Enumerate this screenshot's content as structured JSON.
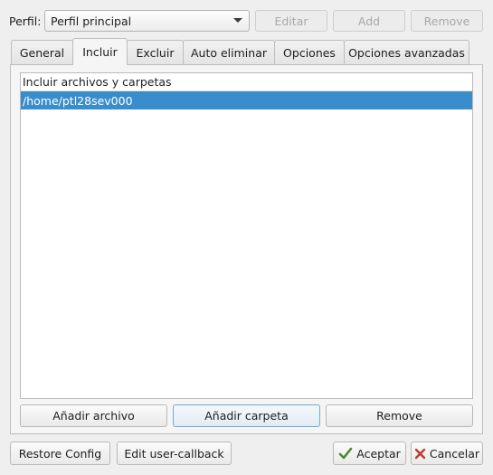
{
  "profile": {
    "label": "Perfil:",
    "selected": "Perfil principal",
    "buttons": {
      "edit": "Editar",
      "add": "Add",
      "remove": "Remove"
    }
  },
  "tabs": [
    {
      "label": "General",
      "active": false
    },
    {
      "label": "Incluir",
      "active": true
    },
    {
      "label": "Excluir",
      "active": false
    },
    {
      "label": "Auto eliminar",
      "active": false
    },
    {
      "label": "Opciones",
      "active": false
    },
    {
      "label": "Opciones avanzadas",
      "active": false
    }
  ],
  "include_list": {
    "header": "Incluir archivos y carpetas",
    "rows": [
      "/home/ptl28sev000"
    ],
    "selected_index": 0
  },
  "list_buttons": {
    "add_file": "Añadir archivo",
    "add_folder": "Añadir carpeta",
    "remove": "Remove"
  },
  "footer": {
    "restore": "Restore Config",
    "edit_callback": "Edit user-callback",
    "accept": "Aceptar",
    "cancel": "Cancelar"
  },
  "colors": {
    "selection": "#3a8dcc",
    "accept_icon": "#4f8a2e",
    "cancel_icon": "#c0392b"
  },
  "icons": {
    "accept": "checkmark-icon",
    "cancel": "close-icon",
    "dropdown": "chevron-down-icon"
  }
}
